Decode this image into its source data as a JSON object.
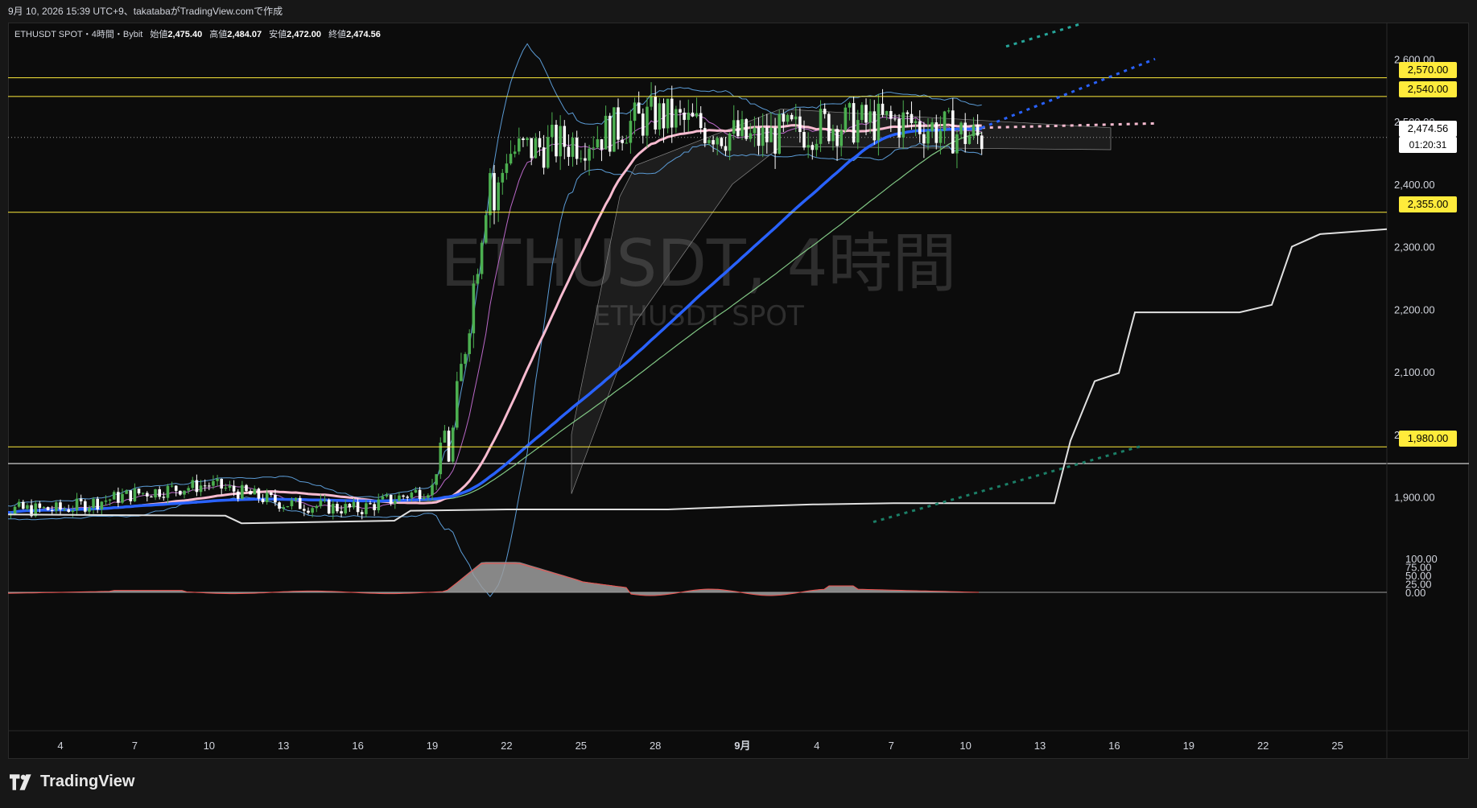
{
  "header": {
    "caption": "9月 10, 2026 15:39 UTC+9、takatabaがTradingView.comで作成"
  },
  "legend": {
    "symbol_line": "ETHUSDT SPOT・4時間・Bybit",
    "open_label": "始値",
    "open": "2,475.40",
    "high_label": "高値",
    "high": "2,484.07",
    "low_label": "安値",
    "low": "2,472.00",
    "close_label": "終値",
    "close": "2,474.56"
  },
  "watermark": {
    "title": "ETHUSDT, 4時間",
    "subtitle": "ETHUSDT SPOT"
  },
  "price_tags": {
    "p2570": "2,570.00",
    "p2540": "2,540.00",
    "p2355": "2,355.00",
    "p1980": "1,980.00",
    "current": "2,474.56",
    "countdown": "01:20:31"
  },
  "footer": {
    "brand": "TradingView"
  },
  "colors": {
    "background": "#0c0c0c",
    "up_candle": "#4caf50",
    "down_candle": "#ffffff",
    "horizontal_lines": "#ffeb3b",
    "ma_blue": "#2962ff",
    "ma_pink": "#f8bbd0",
    "bollinger": "#5b9bd5",
    "envelope_green": "#81c784",
    "rsi_fill": "#9e9e9e",
    "rsi_line": "#ef5350"
  },
  "chart_data": {
    "type": "candlestick",
    "price_axis": {
      "ticks": [
        "2,600.00",
        "2,500.00",
        "2,400.00",
        "2,300.00",
        "2,200.00",
        "2,100.00",
        "2,000.00",
        "1,900.00"
      ],
      "tick_values": [
        2600,
        2500,
        2400,
        2300,
        2200,
        2100,
        2000,
        1900
      ]
    },
    "oscillator_axis": {
      "ticks": [
        "100.00",
        "75.00",
        "50.00",
        "25.00",
        "0.00"
      ],
      "tick_values": [
        100,
        75,
        50,
        25,
        0
      ]
    },
    "time_axis": {
      "labels": [
        "4",
        "7",
        "10",
        "13",
        "16",
        "19",
        "22",
        "25",
        "28",
        "9月",
        "4",
        "7",
        "10",
        "13",
        "16",
        "19",
        "22",
        "25"
      ]
    },
    "horizontal_lines": [
      2570,
      2540,
      2355,
      1980
    ],
    "last_price": 2474.56,
    "key_closes": [
      {
        "label": "4",
        "close": 1880
      },
      {
        "label": "7",
        "close": 1905
      },
      {
        "label": "10",
        "close": 1920
      },
      {
        "label": "13",
        "close": 1890
      },
      {
        "label": "16",
        "close": 1880
      },
      {
        "label": "19",
        "close": 1915
      },
      {
        "label": "22",
        "close": 2450
      },
      {
        "label": "25",
        "close": 2470
      },
      {
        "label": "28",
        "close": 2510
      },
      {
        "label": "9月",
        "close": 2470
      },
      {
        "label": "4",
        "close": 2495
      },
      {
        "label": "7",
        "close": 2500
      },
      {
        "label": "10",
        "close": 2474.56
      }
    ]
  }
}
